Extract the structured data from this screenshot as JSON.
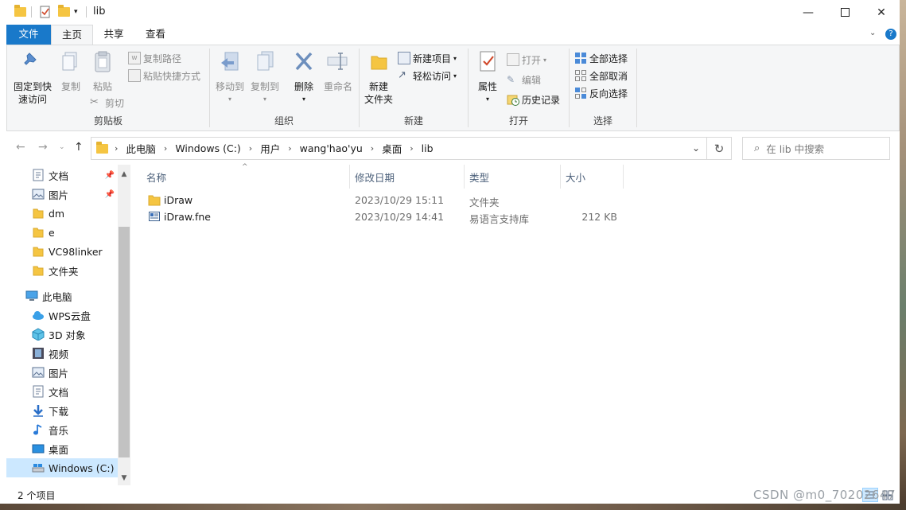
{
  "window": {
    "title": "lib"
  },
  "ribbon_tabs": [
    "文件",
    "主页",
    "共享",
    "查看"
  ],
  "ribbon": {
    "clipboard": {
      "pin_label_1": "固定到快",
      "pin_label_2": "速访问",
      "copy": "复制",
      "paste": "粘贴",
      "copy_path": "复制路径",
      "paste_shortcut": "粘贴快捷方式",
      "cut": "剪切",
      "group": "剪贴板"
    },
    "organize": {
      "move_to": "移动到",
      "copy_to": "复制到",
      "delete": "删除",
      "rename": "重命名",
      "group": "组织"
    },
    "new": {
      "new_folder_1": "新建",
      "new_folder_2": "文件夹",
      "new_item": "新建项目",
      "easy_access": "轻松访问",
      "group": "新建"
    },
    "open": {
      "properties": "属性",
      "open": "打开",
      "edit": "编辑",
      "history": "历史记录",
      "group": "打开"
    },
    "select": {
      "select_all": "全部选择",
      "select_none": "全部取消",
      "invert": "反向选择",
      "group": "选择"
    }
  },
  "breadcrumb": [
    "此电脑",
    "Windows (C:)",
    "用户",
    "wang'hao'yu",
    "桌面",
    "lib"
  ],
  "search": {
    "placeholder": "在 lib 中搜索"
  },
  "nav": {
    "quick_access": [
      {
        "label": "文档",
        "icon": "document-icon",
        "pinned": true
      },
      {
        "label": "图片",
        "icon": "pictures-icon",
        "pinned": true
      },
      {
        "label": "dm",
        "icon": "folder-icon",
        "pinned": false
      },
      {
        "label": "e",
        "icon": "folder-icon",
        "pinned": false
      },
      {
        "label": "VC98linker",
        "icon": "folder-icon",
        "pinned": false
      },
      {
        "label": "文件夹",
        "icon": "folder-icon",
        "pinned": false
      }
    ],
    "this_pc": "此电脑",
    "pc_items": [
      {
        "label": "WPS云盘",
        "icon": "cloud-icon"
      },
      {
        "label": "3D 对象",
        "icon": "3d-objects-icon"
      },
      {
        "label": "视频",
        "icon": "video-icon"
      },
      {
        "label": "图片",
        "icon": "pictures-icon"
      },
      {
        "label": "文档",
        "icon": "document-icon"
      },
      {
        "label": "下载",
        "icon": "download-icon"
      },
      {
        "label": "音乐",
        "icon": "music-icon"
      },
      {
        "label": "桌面",
        "icon": "desktop-icon"
      },
      {
        "label": "Windows (C:)",
        "icon": "drive-icon"
      }
    ]
  },
  "columns": {
    "name": "名称",
    "modified": "修改日期",
    "type": "类型",
    "size": "大小"
  },
  "files": [
    {
      "name": "iDraw",
      "modified": "2023/10/29 15:11",
      "type": "文件夹",
      "size": "",
      "icon": "folder-icon"
    },
    {
      "name": "iDraw.fne",
      "modified": "2023/10/29 14:41",
      "type": "易语言支持库",
      "size": "212 KB",
      "icon": "file-icon"
    }
  ],
  "status": {
    "count": "2 个项目"
  },
  "watermark": "CSDN @m0_70202647"
}
